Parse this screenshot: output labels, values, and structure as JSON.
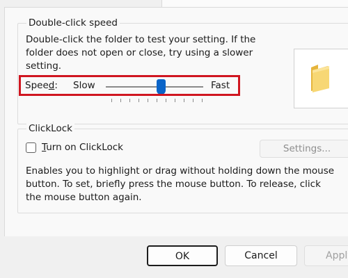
{
  "double_click": {
    "group_label": "Double-click speed",
    "description": "Double-click the folder to test your setting. If the folder does not open or close, try using a slower setting.",
    "speed_label": "Speed:",
    "speed_label_accesskey": "d",
    "slow_label": "Slow",
    "fast_label": "Fast",
    "speed_value_fraction": 0.57,
    "highlight_color": "#d01620"
  },
  "clicklock": {
    "group_label": "ClickLock",
    "checkbox_label": "Turn on ClickLock",
    "checkbox_accesskey": "T",
    "checked": false,
    "settings_button": "Settings...",
    "description": "Enables you to highlight or drag without holding down the mouse button. To set, briefly press the mouse button. To release, click the mouse button again."
  },
  "buttons": {
    "ok": "OK",
    "cancel": "Cancel",
    "apply": "Apply"
  },
  "icons": {
    "preview": "folder-icon"
  }
}
